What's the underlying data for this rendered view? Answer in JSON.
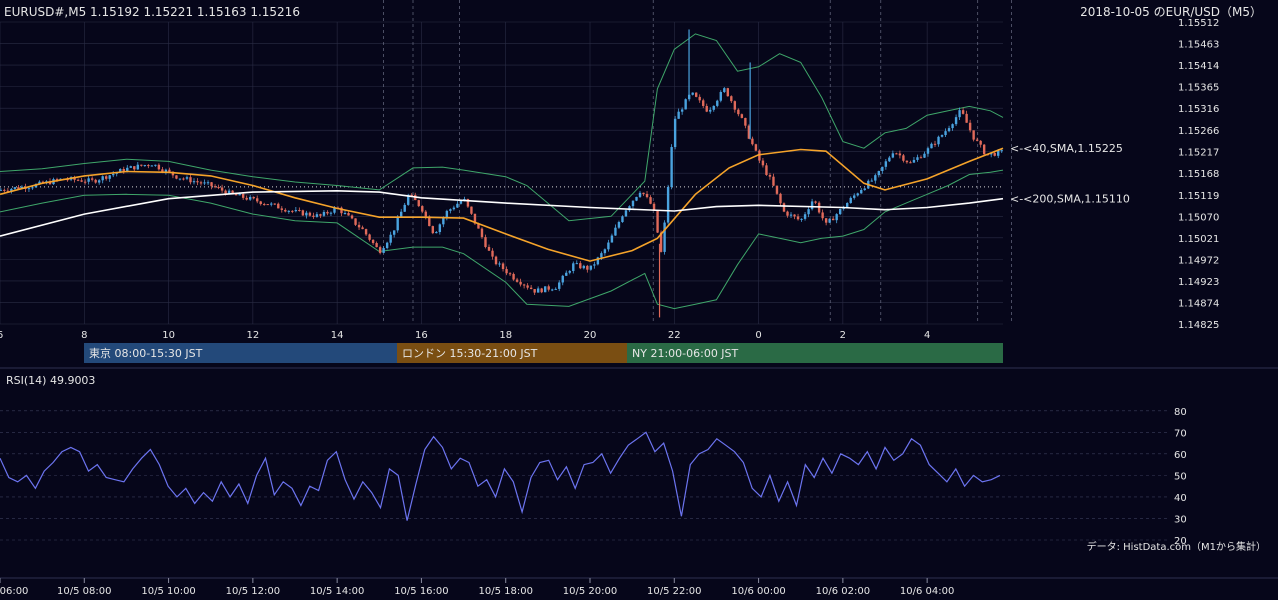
{
  "header": {
    "symbol_info": "EURUSD#,M5 1.15192 1.15221 1.15163 1.15216",
    "date_pair": "2018-10-05 のEUR/USD（M5）"
  },
  "colors": {
    "background": "#06061a",
    "grid": "#2a2c45",
    "candle_up": "#4aa3df",
    "candle_down": "#e06a5a",
    "sma40": "#f5a32a",
    "sma200": "#ffffff",
    "bollinger": "#3fa66a",
    "rsi_line": "#6c74f0",
    "tokyo": "#23497a",
    "london": "#7a4e12",
    "ny": "#2a6a45"
  },
  "sessions": [
    {
      "label": "東京 08:00-15:30 JST"
    },
    {
      "label": "ロンドン 15:30-21:00 JST"
    },
    {
      "label": "NY 21:00-06:00 JST"
    }
  ],
  "rsi": {
    "label": "RSI(14) 49.9003"
  },
  "credit": "データ: HistData.com（M1から集計）",
  "chart_data": [
    {
      "type": "candlestick",
      "title": "2018-10-05 のEUR/USD（M5）",
      "xlim": [
        6,
        29.8
      ],
      "ylim": [
        1.14825,
        1.15512
      ],
      "x_tick_labels": [
        "6",
        "8",
        "10",
        "12",
        "14",
        "16",
        "18",
        "20",
        "22",
        "0",
        "2",
        "4"
      ],
      "y_tick_labels": [
        "1.15512",
        "1.15463",
        "1.15414",
        "1.15365",
        "1.15316",
        "1.15266",
        "1.15217",
        "1.15168",
        "1.15119",
        "1.15070",
        "1.15021",
        "1.14972",
        "1.14923",
        "1.14874",
        "1.14825"
      ],
      "bottom_time_labels": [
        "06:00",
        "10/5 08:00",
        "10/5 10:00",
        "10/5 12:00",
        "10/5 14:00",
        "10/5 16:00",
        "10/5 18:00",
        "10/5 20:00",
        "10/5 22:00",
        "10/6 00:00",
        "10/6 02:00",
        "10/6 04:00"
      ],
      "reference_line": 1.15137,
      "series": [
        {
          "name": "<-<40,SMA,1.15225",
          "kind": "sma",
          "last": 1.15225,
          "points": [
            [
              6,
              1.1512
            ],
            [
              7,
              1.15145
            ],
            [
              8,
              1.15162
            ],
            [
              9,
              1.15172
            ],
            [
              10,
              1.1517
            ],
            [
              11,
              1.15162
            ],
            [
              12,
              1.1514
            ],
            [
              13,
              1.15112
            ],
            [
              14,
              1.15088
            ],
            [
              15,
              1.15068
            ],
            [
              16,
              1.15068
            ],
            [
              17,
              1.15066
            ],
            [
              18,
              1.1503
            ],
            [
              19,
              1.14995
            ],
            [
              20,
              1.14968
            ],
            [
              21,
              1.14992
            ],
            [
              21.6,
              1.1502
            ],
            [
              22.5,
              1.1512
            ],
            [
              23.3,
              1.1518
            ],
            [
              24,
              1.1521
            ],
            [
              25,
              1.15222
            ],
            [
              25.6,
              1.15218
            ],
            [
              26.5,
              1.15145
            ],
            [
              27,
              1.1513
            ],
            [
              28,
              1.15155
            ],
            [
              29,
              1.15195
            ],
            [
              29.8,
              1.15225
            ]
          ]
        },
        {
          "name": "<-<200,SMA,1.15110",
          "kind": "sma",
          "last": 1.1511,
          "points": [
            [
              6,
              1.15025
            ],
            [
              8,
              1.15075
            ],
            [
              10,
              1.1511
            ],
            [
              12,
              1.15125
            ],
            [
              14,
              1.15128
            ],
            [
              15,
              1.15125
            ],
            [
              16,
              1.15112
            ],
            [
              18,
              1.151
            ],
            [
              20,
              1.1509
            ],
            [
              22,
              1.15082
            ],
            [
              23,
              1.15092
            ],
            [
              24,
              1.15095
            ],
            [
              26,
              1.1509
            ],
            [
              27,
              1.15085
            ],
            [
              28,
              1.1509
            ],
            [
              29,
              1.151
            ],
            [
              29.8,
              1.1511
            ]
          ]
        },
        {
          "name": "bollinger_upper",
          "kind": "band",
          "points": [
            [
              6,
              1.15172
            ],
            [
              7,
              1.15178
            ],
            [
              8,
              1.1519
            ],
            [
              9,
              1.152
            ],
            [
              10,
              1.15195
            ],
            [
              11,
              1.15175
            ],
            [
              12,
              1.1516
            ],
            [
              13,
              1.15148
            ],
            [
              14,
              1.1514
            ],
            [
              15,
              1.1513
            ],
            [
              15.8,
              1.1518
            ],
            [
              16.5,
              1.15182
            ],
            [
              17,
              1.15175
            ],
            [
              18,
              1.1516
            ],
            [
              18.5,
              1.1514
            ],
            [
              19.5,
              1.1506
            ],
            [
              20.5,
              1.1507
            ],
            [
              21.3,
              1.1515
            ],
            [
              21.6,
              1.1536
            ],
            [
              22,
              1.1545
            ],
            [
              22.5,
              1.15485
            ],
            [
              23,
              1.1547
            ],
            [
              23.5,
              1.154
            ],
            [
              24,
              1.1541
            ],
            [
              24.5,
              1.1544
            ],
            [
              25,
              1.1542
            ],
            [
              25.5,
              1.1534
            ],
            [
              26,
              1.1524
            ],
            [
              26.5,
              1.15225
            ],
            [
              27,
              1.1526
            ],
            [
              27.5,
              1.1527
            ],
            [
              28,
              1.153
            ],
            [
              28.5,
              1.1531
            ],
            [
              29,
              1.1532
            ],
            [
              29.5,
              1.1531
            ],
            [
              29.8,
              1.15295
            ]
          ]
        },
        {
          "name": "bollinger_lower",
          "kind": "band",
          "points": [
            [
              6,
              1.1508
            ],
            [
              7,
              1.151
            ],
            [
              8,
              1.15118
            ],
            [
              9,
              1.1512
            ],
            [
              10,
              1.15118
            ],
            [
              11,
              1.151
            ],
            [
              12,
              1.15075
            ],
            [
              13,
              1.1506
            ],
            [
              14,
              1.15055
            ],
            [
              15,
              1.1499
            ],
            [
              15.8,
              1.15
            ],
            [
              16.5,
              1.15
            ],
            [
              17,
              1.14985
            ],
            [
              18,
              1.1492
            ],
            [
              18.5,
              1.1487
            ],
            [
              19.5,
              1.14865
            ],
            [
              20.5,
              1.149
            ],
            [
              21.3,
              1.1494
            ],
            [
              21.6,
              1.1487
            ],
            [
              22,
              1.1486
            ],
            [
              22.5,
              1.1487
            ],
            [
              23,
              1.1488
            ],
            [
              23.5,
              1.1496
            ],
            [
              24,
              1.1503
            ],
            [
              24.5,
              1.1502
            ],
            [
              25,
              1.1501
            ],
            [
              25.5,
              1.1502
            ],
            [
              26,
              1.15025
            ],
            [
              26.5,
              1.1504
            ],
            [
              27,
              1.1508
            ],
            [
              27.5,
              1.151
            ],
            [
              28,
              1.1512
            ],
            [
              28.5,
              1.1514
            ],
            [
              29,
              1.15165
            ],
            [
              29.5,
              1.1517
            ],
            [
              29.8,
              1.15175
            ]
          ]
        }
      ],
      "ohlc_path": [
        [
          6,
          1.1513
        ],
        [
          6.8,
          1.1514
        ],
        [
          7.5,
          1.15155
        ],
        [
          8.2,
          1.1515
        ],
        [
          9,
          1.15178
        ],
        [
          9.6,
          1.1519
        ],
        [
          10.2,
          1.1516
        ],
        [
          11,
          1.1514
        ],
        [
          11.5,
          1.1512
        ],
        [
          12.3,
          1.151
        ],
        [
          13,
          1.1508
        ],
        [
          13.6,
          1.1507
        ],
        [
          14,
          1.1509
        ],
        [
          14.6,
          1.1504
        ],
        [
          15,
          1.1499
        ],
        [
          15.3,
          1.1503
        ],
        [
          15.7,
          1.1512
        ],
        [
          16,
          1.1509
        ],
        [
          16.3,
          1.1503
        ],
        [
          16.6,
          1.1508
        ],
        [
          17,
          1.1511
        ],
        [
          17.3,
          1.1505
        ],
        [
          17.7,
          1.1497
        ],
        [
          18.2,
          1.1493
        ],
        [
          18.7,
          1.149
        ],
        [
          19.2,
          1.1491
        ],
        [
          19.6,
          1.1496
        ],
        [
          20,
          1.1495
        ],
        [
          20.4,
          1.15
        ],
        [
          20.8,
          1.1508
        ],
        [
          21.2,
          1.1513
        ],
        [
          21.5,
          1.1509
        ],
        [
          21.7,
          1.1498
        ],
        [
          22,
          1.1529
        ],
        [
          22.4,
          1.1535
        ],
        [
          22.8,
          1.1531
        ],
        [
          23.2,
          1.1536
        ],
        [
          23.6,
          1.1529
        ],
        [
          24,
          1.152
        ],
        [
          24.3,
          1.1515
        ],
        [
          24.6,
          1.1508
        ],
        [
          25,
          1.1506
        ],
        [
          25.3,
          1.1511
        ],
        [
          25.6,
          1.1505
        ],
        [
          26,
          1.1509
        ],
        [
          26.4,
          1.1513
        ],
        [
          26.8,
          1.1516
        ],
        [
          27.2,
          1.1522
        ],
        [
          27.6,
          1.1519
        ],
        [
          28,
          1.1522
        ],
        [
          28.4,
          1.1526
        ],
        [
          28.8,
          1.1531
        ],
        [
          29.1,
          1.1525
        ],
        [
          29.4,
          1.1521
        ],
        [
          29.8,
          1.15216
        ]
      ],
      "spikes": [
        {
          "x": 21.65,
          "low": 1.1484
        },
        {
          "x": 22.35,
          "high": 1.15495
        },
        {
          "x": 23.8,
          "high": 1.1542
        }
      ]
    },
    {
      "type": "line",
      "title": "RSI(14) 49.9003",
      "ylim": [
        20,
        85
      ],
      "y_tick_labels": [
        "80",
        "70",
        "60",
        "50",
        "40",
        "30",
        "20"
      ],
      "grid_levels": [
        80,
        70,
        60,
        50,
        40,
        30,
        20
      ],
      "series": [
        {
          "name": "RSI(14) 49.9003",
          "values": [
            58,
            49,
            47,
            50,
            44,
            52,
            56,
            61,
            63,
            61,
            52,
            55,
            49,
            48,
            47,
            53,
            58,
            62,
            55,
            45,
            40,
            44,
            37,
            42,
            38,
            47,
            40,
            46,
            37,
            50,
            58,
            41,
            47,
            44,
            36,
            45,
            43,
            57,
            61,
            48,
            39,
            47,
            42,
            35,
            53,
            50,
            29,
            46,
            62,
            68,
            63,
            53,
            58,
            56,
            45,
            48,
            40,
            53,
            47,
            33,
            49,
            56,
            57,
            48,
            54,
            44,
            55,
            56,
            60,
            51,
            58,
            64,
            67,
            70,
            61,
            65,
            52,
            31,
            55,
            60,
            62,
            67,
            64,
            61,
            56,
            44,
            40,
            50,
            38,
            47,
            36,
            55,
            49,
            58,
            51,
            60,
            58,
            55,
            61,
            53,
            63,
            57,
            60,
            67,
            64,
            55,
            51,
            47,
            53,
            45,
            50,
            47,
            48,
            50
          ]
        }
      ]
    }
  ]
}
